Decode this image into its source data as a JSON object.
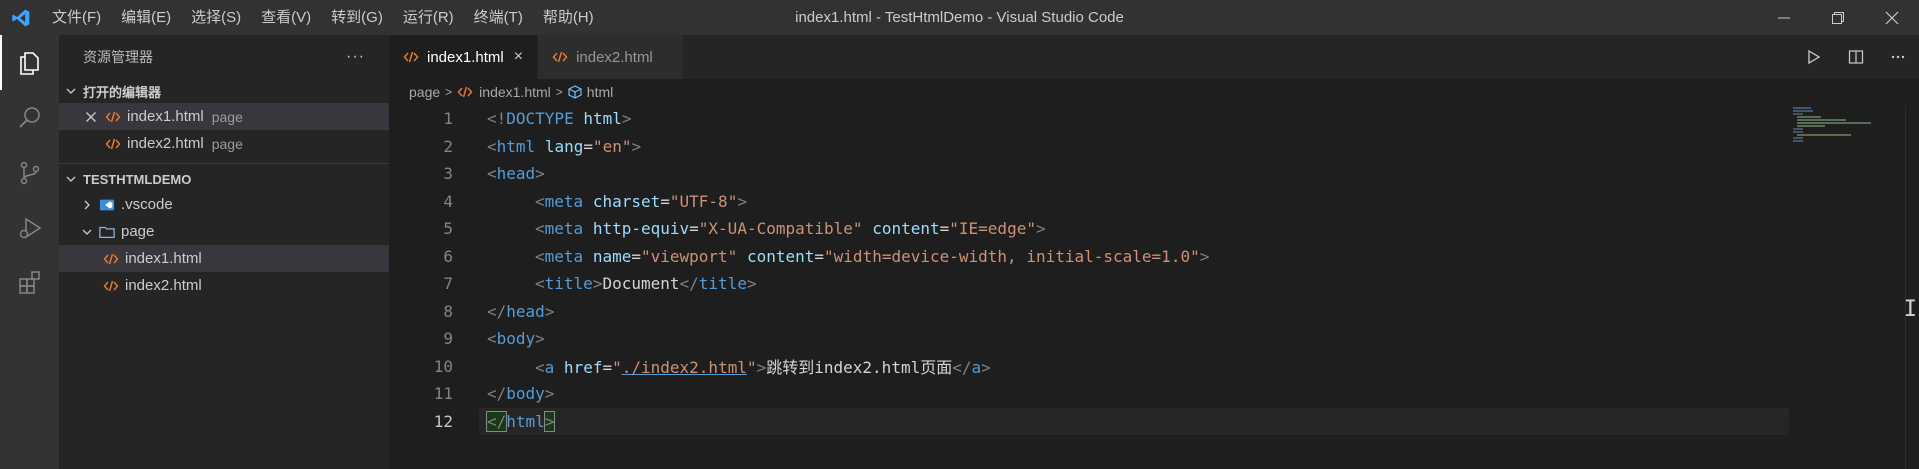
{
  "titlebar": {
    "title": "index1.html - TestHtmlDemo - Visual Studio Code",
    "menus": [
      "文件(F)",
      "编辑(E)",
      "选择(S)",
      "查看(V)",
      "转到(G)",
      "运行(R)",
      "终端(T)",
      "帮助(H)"
    ]
  },
  "sidebar": {
    "title": "资源管理器",
    "more": "···",
    "open_editors": {
      "label": "打开的编辑器",
      "items": [
        {
          "name": "index1.html",
          "desc": "page"
        },
        {
          "name": "index2.html",
          "desc": "page"
        }
      ]
    },
    "workspace": {
      "label": "TESTHTMLDEMO",
      "items": [
        {
          "name": ".vscode"
        },
        {
          "name": "page"
        },
        {
          "name": "index1.html"
        },
        {
          "name": "index2.html"
        }
      ]
    }
  },
  "editor": {
    "tabs": [
      {
        "label": "index1.html",
        "close": "×"
      },
      {
        "label": "index2.html"
      }
    ],
    "breadcrumb": [
      "page",
      "index1.html",
      "html"
    ],
    "line_numbers": [
      "1",
      "2",
      "3",
      "4",
      "5",
      "6",
      "7",
      "8",
      "9",
      "10",
      "11",
      "12"
    ],
    "code": {
      "l1": {
        "open": "<!",
        "doctype": "DOCTYPE",
        "html": "html",
        "close": ">"
      },
      "l2": {
        "open": "<",
        "tag": "html",
        "attr": "lang",
        "eq": "=",
        "val": "\"en\"",
        "close": ">"
      },
      "l3": {
        "open": "<",
        "tag": "head",
        "close": ">"
      },
      "l4": {
        "open": "<",
        "tag": "meta",
        "attr": "charset",
        "eq": "=",
        "val": "\"UTF-8\"",
        "close": ">"
      },
      "l5": {
        "open": "<",
        "tag": "meta",
        "attr1": "http-equiv",
        "eq1": "=",
        "val1": "\"X-UA-Compatible\"",
        "attr2": "content",
        "eq2": "=",
        "val2": "\"IE=edge\"",
        "close": ">"
      },
      "l6": {
        "open": "<",
        "tag": "meta",
        "attr1": "name",
        "eq1": "=",
        "val1": "\"viewport\"",
        "attr2": "content",
        "eq2": "=",
        "val2": "\"width=device-width, initial-scale=1.0\"",
        "close": ">"
      },
      "l7": {
        "open": "<",
        "tag": "title",
        "close": ">",
        "text": "Document",
        "end_open": "</",
        "end_tag": "title",
        "end_close": ">"
      },
      "l8": {
        "open": "</",
        "tag": "head",
        "close": ">"
      },
      "l9": {
        "open": "<",
        "tag": "body",
        "close": ">"
      },
      "l10": {
        "open": "<",
        "tag": "a",
        "attr": "href",
        "eq": "=",
        "q1": "\"",
        "link": "./index2.html",
        "q2": "\"",
        "close": ">",
        "text": "跳转到index2.html页面",
        "end_open": "</",
        "end_tag": "a",
        "end_close": ">"
      },
      "l11": {
        "open": "</",
        "tag": "body",
        "close": ">"
      },
      "l12": {
        "open": "</",
        "tag": "html",
        "close": ">"
      }
    }
  },
  "colors": {
    "accent": "#007acc",
    "html_icon": "#e37933",
    "folder_icon": "#8fb4e3"
  }
}
